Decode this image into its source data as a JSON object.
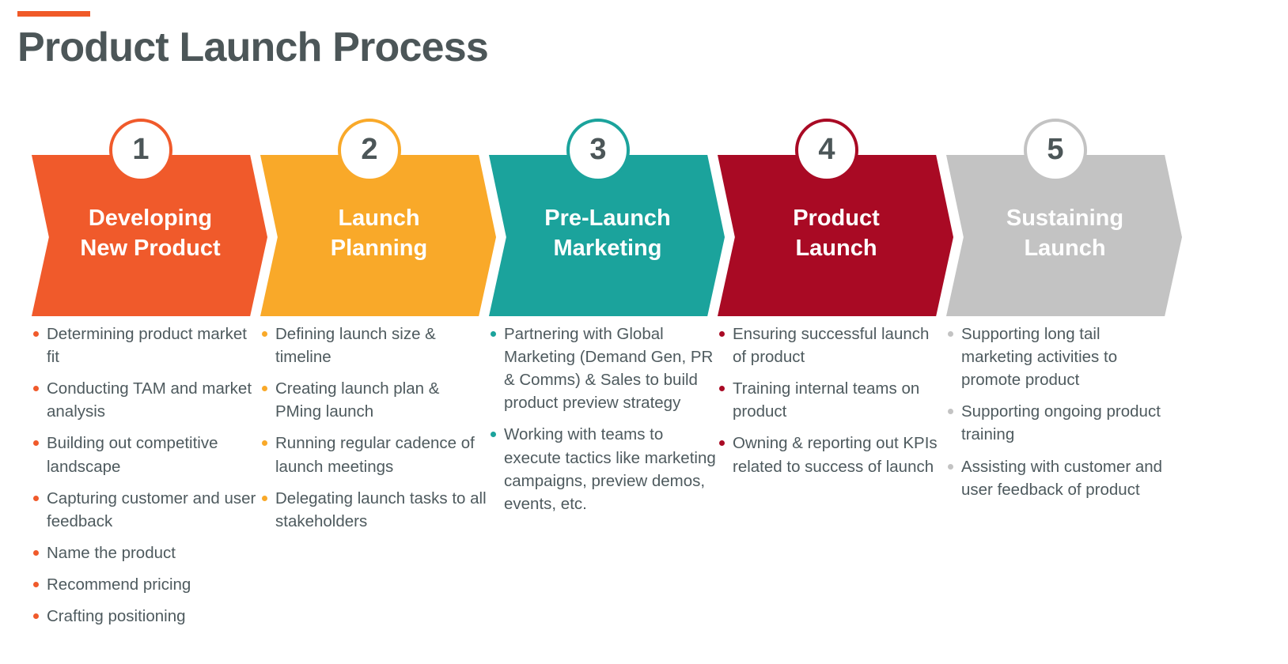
{
  "header": {
    "title": "Product Launch Process",
    "accent_color": "#f05a28"
  },
  "theme": {
    "title_color": "#4c5658",
    "body_text_color": "#4e5a5e",
    "background": "#ffffff"
  },
  "process": {
    "steps": [
      {
        "number": "1",
        "title": "Developing\nNew Product",
        "color": "#f05a2b",
        "bullets": [
          "Determining product market fit",
          "Conducting TAM and market analysis",
          "Building out competitive landscape",
          "Capturing customer and user feedback",
          "Name the product",
          "Recommend pricing",
          "Crafting positioning"
        ]
      },
      {
        "number": "2",
        "title": "Launch\nPlanning",
        "color": "#f9a929",
        "bullets": [
          "Defining launch size & timeline",
          "Creating launch plan & PMing launch",
          "Running regular cadence of launch meetings",
          "Delegating launch tasks to all stakeholders"
        ]
      },
      {
        "number": "3",
        "title": "Pre-Launch\nMarketing",
        "color": "#1ba39c",
        "bullets": [
          "Partnering with Global Marketing (Demand Gen, PR & Comms) & Sales to build product preview strategy",
          "Working with teams to execute tactics like marketing campaigns, preview demos, events, etc."
        ]
      },
      {
        "number": "4",
        "title": "Product\nLaunch",
        "color": "#a90a24",
        "bullets": [
          "Ensuring successful launch of product",
          "Training internal teams on product",
          "Owning & reporting out KPIs related to success of launch"
        ]
      },
      {
        "number": "5",
        "title": "Sustaining\nLaunch",
        "color": "#c3c3c3",
        "bullets": [
          "Supporting long tail marketing activities to promote product",
          "Supporting ongoing product training",
          "Assisting with customer and user feedback of product"
        ]
      }
    ]
  }
}
